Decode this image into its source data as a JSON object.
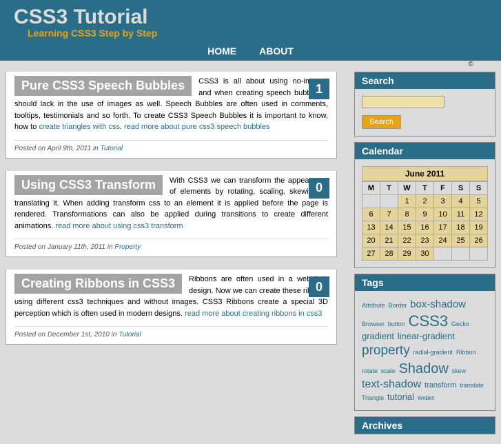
{
  "header": {
    "title": "CSS3 Tutorial",
    "tagline": "Learning CSS3 Step by Step",
    "nav": {
      "home": "HOME",
      "about": "ABOUT"
    },
    "copyright": "©"
  },
  "posts": [
    {
      "title": "Pure CSS3 Speech Bubbles",
      "comments": "1",
      "excerpt_start": "CSS3 is all about using no-images and when creating speech bubbles it should lack in the use of images as well. Speech Bubbles are often used in comments, tooltips, testimonials and so forth. To create CSS3 Speech Bubbles it is important to know, how to ",
      "link1": "create triangles with css",
      "sep": ". ",
      "link2": "read more about pure css3 speech bubbles",
      "meta_prefix": "Posted on ",
      "date": "April 9th, 2011",
      "meta_in": " in ",
      "category": "Tutorial"
    },
    {
      "title": "Using CSS3 Transform",
      "comments": "0",
      "excerpt_start": "With CSS3 we can transform the appearance of elements by rotating, scaling, skewing or translating it. When adding transform css to an element it is applied before the page is rendered. Transformations can also be applied during transitions to create different animations. ",
      "link1": "",
      "sep": "",
      "link2": "read more about using css3 transform",
      "meta_prefix": "Posted on ",
      "date": "January 11th, 2011",
      "meta_in": " in ",
      "category": "Property"
    },
    {
      "title": "Creating Ribbons in CSS3",
      "comments": "0",
      "excerpt_start": "Ribbons are often used in a website's design. Now we can create these ribbons using different css3 techniques and without images. CSS3 Ribbons create a special 3D perception which is often used in modern designs. ",
      "link1": "",
      "sep": "",
      "link2": "read more about creating ribbons in css3",
      "meta_prefix": "Posted on ",
      "date": "December 1st, 2010",
      "meta_in": " in ",
      "category": "Tutorial"
    }
  ],
  "sidebar": {
    "search": {
      "title": "Search",
      "button": "Search",
      "placeholder": ""
    },
    "calendar": {
      "title": "Calendar",
      "caption": "June 2011",
      "days": [
        "M",
        "T",
        "W",
        "T",
        "F",
        "S",
        "S"
      ],
      "weeks": [
        [
          "",
          "",
          "1",
          "2",
          "3",
          "4",
          "5"
        ],
        [
          "6",
          "7",
          "8",
          "9",
          "10",
          "11",
          "12"
        ],
        [
          "13",
          "14",
          "15",
          "16",
          "17",
          "18",
          "19"
        ],
        [
          "20",
          "21",
          "22",
          "23",
          "24",
          "25",
          "26"
        ],
        [
          "27",
          "28",
          "29",
          "30",
          "",
          "",
          ""
        ]
      ]
    },
    "tags": {
      "title": "Tags",
      "items": [
        {
          "t": "Attribute",
          "s": 9
        },
        {
          "t": "Border",
          "s": 9
        },
        {
          "t": "box-shadow",
          "s": 15
        },
        {
          "t": "Browser",
          "s": 9
        },
        {
          "t": "button",
          "s": 9
        },
        {
          "t": "CSS3",
          "s": 22
        },
        {
          "t": "Gecko",
          "s": 9
        },
        {
          "t": "gradient",
          "s": 13
        },
        {
          "t": "linear-gradient",
          "s": 13
        },
        {
          "t": "property",
          "s": 19
        },
        {
          "t": "radial-gradient",
          "s": 9
        },
        {
          "t": "Ribbon",
          "s": 9
        },
        {
          "t": "rotate",
          "s": 9
        },
        {
          "t": "scale",
          "s": 9
        },
        {
          "t": "Shadow",
          "s": 20
        },
        {
          "t": "skew",
          "s": 9
        },
        {
          "t": "text-shadow",
          "s": 16
        },
        {
          "t": "transform",
          "s": 11
        },
        {
          "t": "translate",
          "s": 9
        },
        {
          "t": "Triangle",
          "s": 9
        },
        {
          "t": "tutorial",
          "s": 13
        },
        {
          "t": "Webkit",
          "s": 8
        }
      ]
    },
    "archives": {
      "title": "Archives"
    }
  }
}
